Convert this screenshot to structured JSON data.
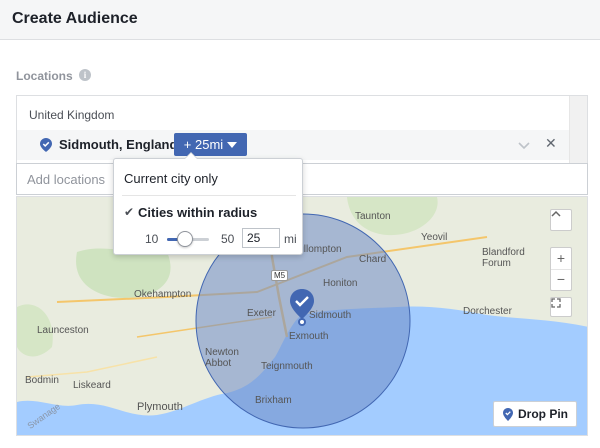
{
  "header": {
    "title": "Create Audience"
  },
  "locations": {
    "label": "Locations",
    "info_icon": "info-icon",
    "country": "United Kingdom",
    "selected_location": "Sidmouth, England",
    "radius_button_label": "+ 25mi",
    "add_placeholder": "Add locations"
  },
  "dropdown": {
    "option_current": "Current city only",
    "option_radius": "Cities within radius",
    "check_glyph": "✔",
    "slider_min": "10",
    "slider_max": "50",
    "slider_fraction": 0.375,
    "radius_value": "25",
    "radius_unit": "mi"
  },
  "map": {
    "labels": [
      "Taunton",
      "Yeovil",
      "Chard",
      "Blandford Forum",
      "Cullompton",
      "Honiton",
      "Okehampton",
      "Exeter",
      "Sidmouth",
      "Exmouth",
      "Launceston",
      "Newton Abbot",
      "Teignmouth",
      "Bodmin",
      "Liskeard",
      "Plymouth",
      "Brixham",
      "Dorchester",
      "Swanage"
    ],
    "road_labels": [
      "M5"
    ],
    "controls": {
      "zoom_in": "+",
      "zoom_out": "−",
      "fullscreen_icon": "fullscreen-icon",
      "expand_icon": "chevron-up-icon"
    },
    "drop_pin_label": "Drop Pin"
  },
  "colors": {
    "accent": "#4267b2",
    "radius_fill": "#6f8cc7",
    "pin": "#4267b2",
    "sea": "#a3ccff",
    "land": "#e9ecdf"
  }
}
